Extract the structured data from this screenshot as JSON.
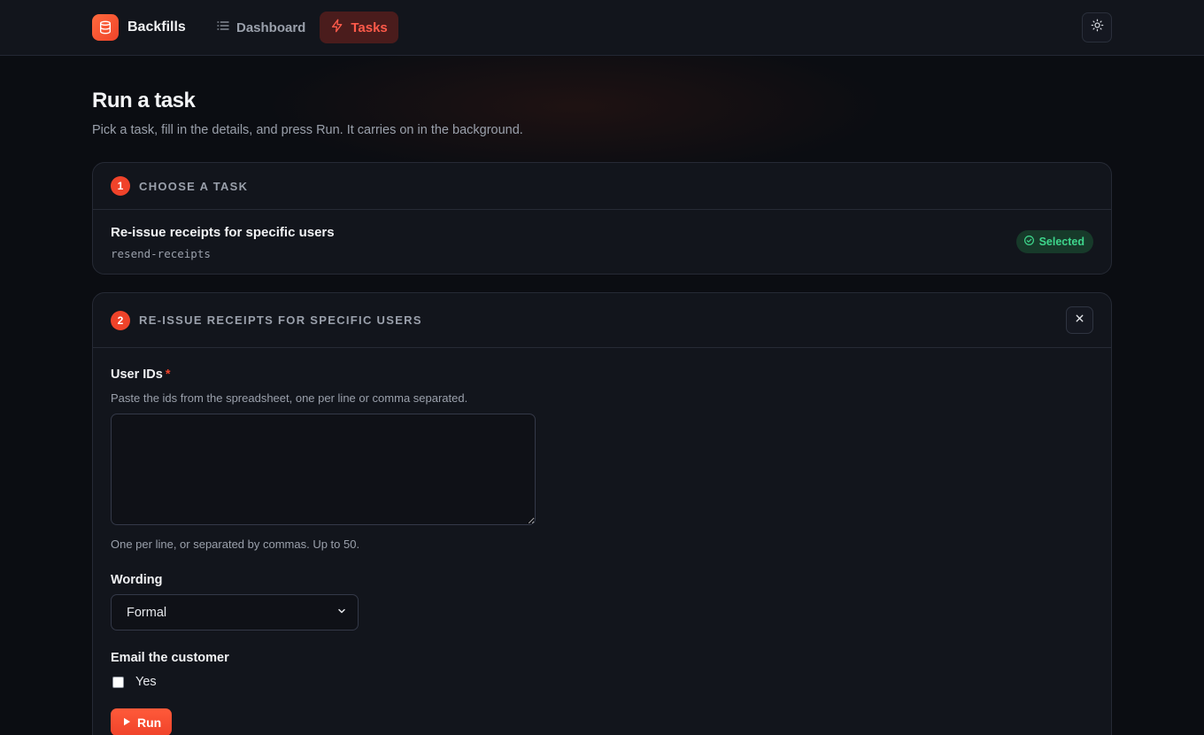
{
  "app": {
    "name": "Backfills"
  },
  "nav": [
    {
      "label": "Dashboard",
      "icon": "list-icon",
      "active": false
    },
    {
      "label": "Tasks",
      "icon": "bolt-icon",
      "active": true
    }
  ],
  "theme_toggle": {
    "icon": "sun-icon"
  },
  "page": {
    "title": "Run a task",
    "subtitle": "Pick a task, fill in the details, and press Run. It carries on in the background."
  },
  "step1": {
    "number": "1",
    "title": "Choose a task",
    "task": {
      "name": "Re-issue receipts for specific users",
      "code": "resend-receipts"
    },
    "badge": "Selected"
  },
  "step2": {
    "number": "2",
    "title": "Re-issue receipts for specific users",
    "fields": {
      "user_ids": {
        "label": "User IDs",
        "required_mark": "*",
        "description": "Paste the ids from the spreadsheet, one per line or comma separated.",
        "value": "",
        "hint": "One per line, or separated by commas. Up to 50."
      },
      "wording": {
        "label": "Wording",
        "selected": "Formal"
      },
      "email": {
        "label": "Email the customer",
        "option_label": "Yes",
        "checked": false
      }
    },
    "run_label": "Run"
  },
  "colors": {
    "accent": "#f0432a",
    "success": "#3ed68c",
    "background": "#0b0d12",
    "surface": "#12151c"
  }
}
